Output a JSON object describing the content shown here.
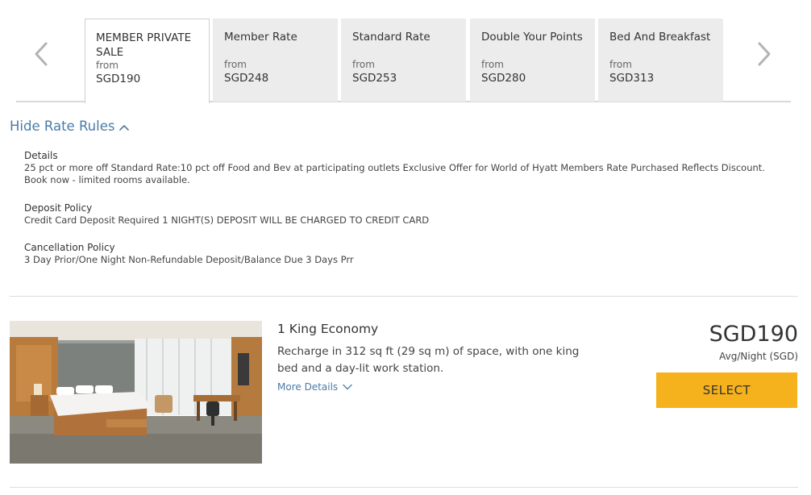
{
  "rate_tabs": [
    {
      "name": "MEMBER PRIVATE SALE",
      "from_label": "from",
      "price": "SGD190",
      "active": true
    },
    {
      "name": "Member Rate",
      "from_label": "from",
      "price": "SGD248",
      "active": false
    },
    {
      "name": "Standard Rate",
      "from_label": "from",
      "price": "SGD253",
      "active": false
    },
    {
      "name": "Double Your Points",
      "from_label": "from",
      "price": "SGD280",
      "active": false
    },
    {
      "name": "Bed And Breakfast",
      "from_label": "from",
      "price": "SGD313",
      "active": false
    }
  ],
  "carousel": {
    "prev_icon": "chevron-left-icon",
    "next_icon": "chevron-right-icon"
  },
  "rate_rules": {
    "toggle_label": "Hide Rate Rules",
    "toggle_icon": "chevron-up-icon",
    "details": {
      "title": "Details",
      "body": "25 pct or more off Standard Rate:10 pct off Food and Bev at participating outlets Exclusive Offer for World of Hyatt Members Rate Purchased Reflects Discount. Book now - limited rooms available."
    },
    "deposit": {
      "title": "Deposit Policy",
      "body": "Credit Card Deposit Required 1 NIGHT(S) DEPOSIT WILL BE CHARGED TO CREDIT CARD"
    },
    "cancellation": {
      "title": "Cancellation Policy",
      "body": "3 Day Prior/One Night Non-Refundable Deposit/Balance Due 3 Days Prr"
    }
  },
  "room": {
    "title": "1 King Economy",
    "description": "Recharge in 312 sq ft (29 sq m) of space, with one king bed and a day-lit work station.",
    "more_details_label": "More Details",
    "more_details_icon": "chevron-down-icon",
    "price": "SGD190",
    "price_note": "Avg/Night (SGD)",
    "select_label": "SELECT"
  },
  "colors": {
    "link": "#4a7ba8",
    "select_button": "#f5b21c",
    "tab_inactive": "#ececec",
    "text": "#333333"
  }
}
